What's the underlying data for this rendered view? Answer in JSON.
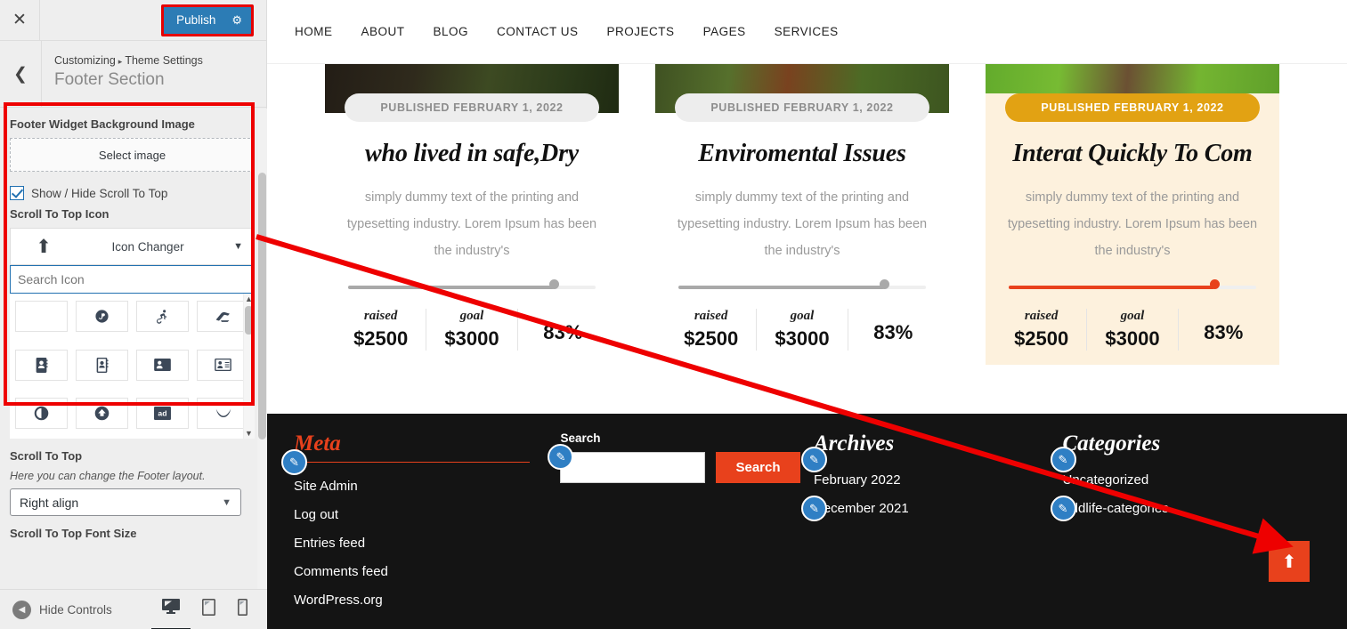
{
  "customizer": {
    "close_icon": "close-icon",
    "publish_label": "Publish",
    "gear_icon": "gear-icon",
    "back_icon": "chevron-left-icon",
    "breadcrumb_root": "Customizing",
    "breadcrumb_sep": "▸",
    "breadcrumb_parent": "Theme Settings",
    "panel_title": "Footer Section",
    "bg_image_label": "Footer Widget Background Image",
    "select_image_label": "Select image",
    "show_hide_label": "Show / Hide Scroll To Top",
    "show_hide_checked": true,
    "scroll_icon_label": "Scroll To Top Icon",
    "icon_changer_label": "Icon Changer",
    "icon_preview_glyph": "⬆",
    "search_icon_placeholder": "Search Icon",
    "search_icon_value": "",
    "icon_grid": [
      {
        "name": "blank-icon"
      },
      {
        "name": "five-hundred-px-icon"
      },
      {
        "name": "accessible-icon"
      },
      {
        "name": "accusoft-icon"
      },
      {
        "name": "address-book-icon"
      },
      {
        "name": "address-book-outline-icon"
      },
      {
        "name": "address-card-icon"
      },
      {
        "name": "address-card-outline-icon"
      },
      {
        "name": "adjust-icon"
      },
      {
        "name": "arrow-alt-circle-up-icon"
      },
      {
        "name": "ad-icon"
      },
      {
        "name": "adn-icon"
      }
    ],
    "scroll_to_top_label": "Scroll To Top",
    "footer_layout_desc": "Here you can change the Footer layout.",
    "footer_layout_value": "Right align",
    "font_size_label": "Scroll To Top Font Size",
    "hide_controls_label": "Hide Controls",
    "devices": [
      {
        "name": "desktop-preview-icon",
        "active": true
      },
      {
        "name": "tablet-preview-icon",
        "active": false
      },
      {
        "name": "mobile-preview-icon",
        "active": false
      }
    ],
    "highlight_color": "#ee0000",
    "publish_color": "#2c7cb5"
  },
  "site": {
    "nav": [
      {
        "label": "HOME"
      },
      {
        "label": "ABOUT"
      },
      {
        "label": "BLOG"
      },
      {
        "label": "CONTACT US"
      },
      {
        "label": "PROJECTS"
      },
      {
        "label": "PAGES"
      },
      {
        "label": "SERVICES"
      }
    ],
    "cards": [
      {
        "published": "PUBLISHED FEBRUARY 1, 2022",
        "title": "who lived in safe,Dry",
        "text": "simply dummy text of the printing and typesetting industry. Lorem Ipsum has been the industry's",
        "progress": 83,
        "raised_label": "raised",
        "raised_value": "$2500",
        "goal_label": "goal",
        "goal_value": "$3000",
        "percent": "83%",
        "featured": false
      },
      {
        "published": "PUBLISHED FEBRUARY 1, 2022",
        "title": "Enviromental Issues",
        "text": "simply dummy text of the printing and typesetting industry. Lorem Ipsum has been the industry's",
        "progress": 83,
        "raised_label": "raised",
        "raised_value": "$2500",
        "goal_label": "goal",
        "goal_value": "$3000",
        "percent": "83%",
        "featured": false
      },
      {
        "published": "PUBLISHED FEBRUARY 1, 2022",
        "title": "Interat Quickly To Com",
        "text": "simply dummy text of the printing and typesetting industry. Lorem Ipsum has been the industry's",
        "progress": 83,
        "raised_label": "raised",
        "raised_value": "$2500",
        "goal_label": "goal",
        "goal_value": "$3000",
        "percent": "83%",
        "featured": true
      }
    ],
    "footer": {
      "meta": {
        "title": "Meta",
        "links": [
          {
            "label": "Site Admin"
          },
          {
            "label": "Log out"
          },
          {
            "label": "Entries feed"
          },
          {
            "label": "Comments feed"
          },
          {
            "label": "WordPress.org"
          }
        ]
      },
      "search": {
        "title": "Search",
        "value": "",
        "button_label": "Search"
      },
      "archives": {
        "title": "Archives",
        "items": [
          {
            "label": "February 2022"
          },
          {
            "label": "December 2021"
          }
        ]
      },
      "categories": {
        "title": "Categories",
        "items": [
          {
            "label": "Uncategorized"
          },
          {
            "label": "wildlife-categories"
          }
        ]
      },
      "scroll_top_glyph": "⬆",
      "accent_color": "#e8411c",
      "background_color": "#141414"
    }
  },
  "annotation": {
    "color": "#ee0000",
    "from": "Scroll To Top Icon control",
    "to": "Scroll to top button in preview"
  }
}
